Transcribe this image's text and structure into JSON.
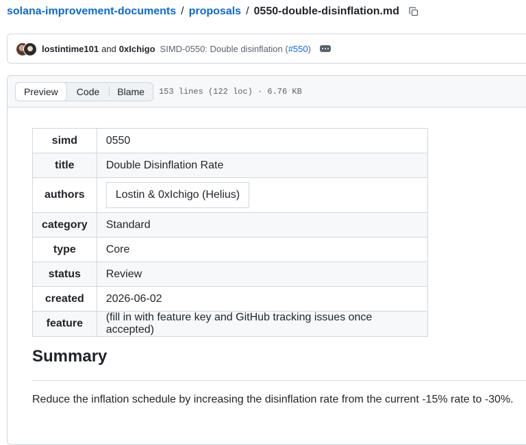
{
  "breadcrumb": {
    "repo": "solana-improvement-documents",
    "separator": "/",
    "folder": "proposals",
    "file": "0550-double-disinflation.md"
  },
  "commit": {
    "author1": "lostintime101",
    "and": "and",
    "author2": "0xIchigo",
    "message": "SIMD-0550: Double disinflation (",
    "pr": "#550",
    "message_end": ")"
  },
  "file_header": {
    "tabs": [
      "Preview",
      "Code",
      "Blame"
    ],
    "info": "153 lines (122 loc) · 6.76 KB"
  },
  "frontmatter": [
    {
      "key": "simd",
      "value": "0550"
    },
    {
      "key": "title",
      "value": "Double Disinflation Rate"
    },
    {
      "key": "authors",
      "value": "Lostin & 0xIchigo (Helius)"
    },
    {
      "key": "category",
      "value": "Standard"
    },
    {
      "key": "type",
      "value": "Core"
    },
    {
      "key": "status",
      "value": "Review"
    },
    {
      "key": "created",
      "value": "2026-06-02"
    },
    {
      "key": "feature",
      "value": "(fill in with feature key and GitHub tracking issues once accepted)"
    }
  ],
  "summary": {
    "heading": "Summary",
    "text": "Reduce the inflation schedule by increasing the disinflation rate from the current -15% rate to -30%."
  },
  "colors": {
    "link": "#0969da",
    "border": "#d0d7de",
    "muted": "#59636e"
  },
  "icons": [
    "copy-icon",
    "kebab-icon",
    "avatar"
  ]
}
